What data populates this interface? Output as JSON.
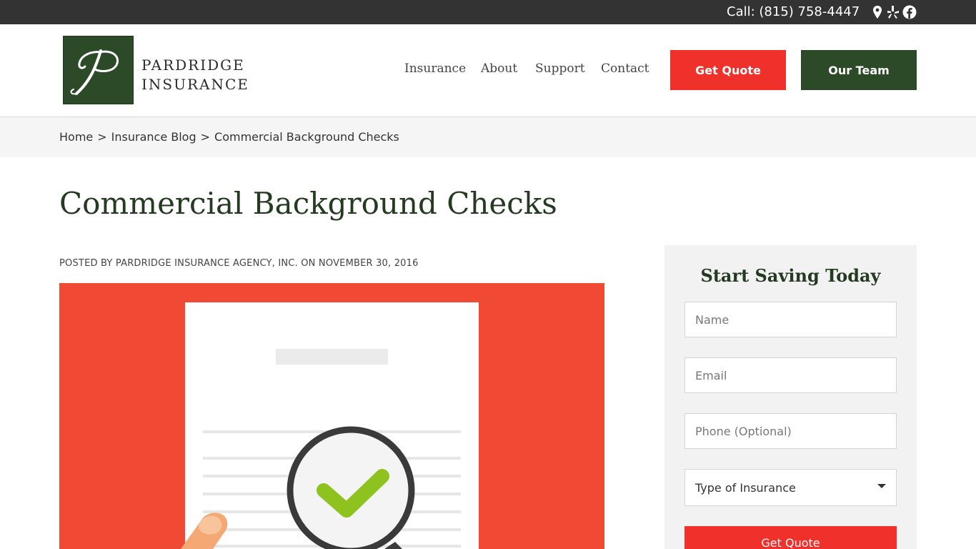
{
  "topbar": {
    "phone": "Call: (815) 758-4447",
    "icons": [
      "map-pin-icon",
      "yelp-icon",
      "facebook-icon"
    ]
  },
  "header": {
    "logo_line1": "PARDRIDGE",
    "logo_line2": "INSURANCE",
    "nav": [
      "Insurance",
      "About",
      "Support",
      "Contact"
    ],
    "quote_button": "Get Quote",
    "team_button": "Our Team"
  },
  "breadcrumb": {
    "home": "Home",
    "sep": ">",
    "blog": "Insurance Blog",
    "current": "Commercial Background Checks"
  },
  "article": {
    "title": "Commercial Background Checks",
    "posted": "POSTED BY PARDRIDGE INSURANCE AGENCY, INC. ON NOVEMBER 30, 2016"
  },
  "sidebar": {
    "heading": "Start Saving Today",
    "name_placeholder": "Name",
    "email_placeholder": "Email",
    "phone_placeholder": "Phone (Optional)",
    "type_selected": "Type of Insurance",
    "submit": "Get Quote"
  },
  "colors": {
    "brand_green": "#2c4a28",
    "accent_red": "#f0302a",
    "hero_red": "#f04a35",
    "check_green": "#8dc21f"
  }
}
